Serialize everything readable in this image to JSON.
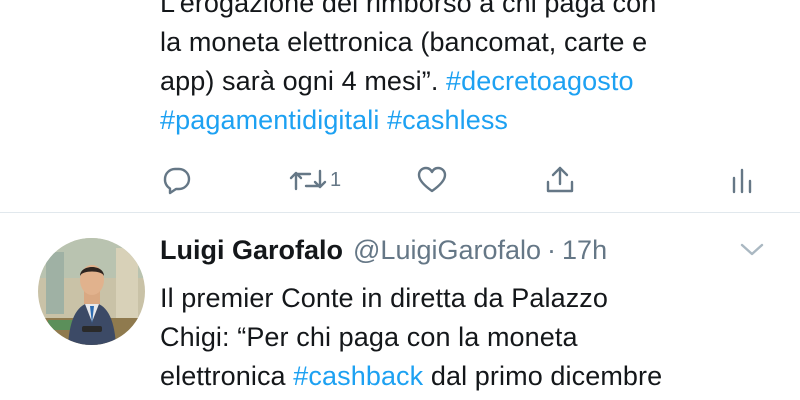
{
  "tweet1": {
    "lines": [
      [
        "L’erogazione del rimborso a chi paga con"
      ],
      [
        "la moneta elettronica (bancomat, carte e"
      ],
      [
        "app) sarà ogni 4 mesi”. ",
        "#decretoagosto"
      ],
      [
        "#pagamentidigitali",
        " ",
        "#cashless"
      ]
    ],
    "actions": {
      "reply_icon": "reply-icon",
      "retweet_icon": "retweet-icon",
      "retweet_count": "1",
      "like_icon": "heart-icon",
      "share_icon": "share-icon",
      "analytics_icon": "analytics-icon"
    }
  },
  "tweet2": {
    "author_name": "Luigi Garofalo",
    "author_handle": "@LuigiGarofalo",
    "separator": "·",
    "time": "17h",
    "menu_icon": "chevron-down-icon",
    "lines": [
      [
        "Il premier Conte in diretta da Palazzo"
      ],
      [
        "Chigi: “Per chi paga con la moneta"
      ],
      [
        "elettronica ",
        "#cashback",
        " dal primo dicembre"
      ]
    ]
  },
  "colors": {
    "text": "#14171a",
    "secondary": "#657786",
    "hashtag": "#1da1f2",
    "divider": "#e1e8ed"
  }
}
